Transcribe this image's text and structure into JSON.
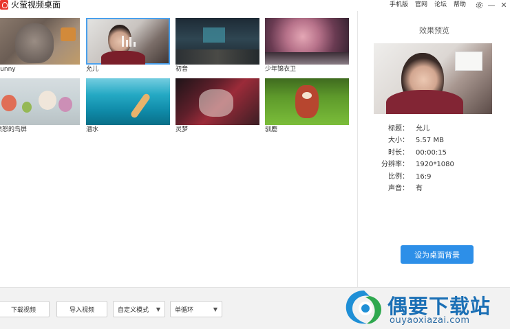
{
  "app": {
    "title": "火萤视频桌面"
  },
  "top_links": [
    "手机版",
    "官网",
    "论坛",
    "帮助"
  ],
  "window_controls": {
    "settings_icon": "gear-icon",
    "minimize": "—",
    "close": "✕"
  },
  "wallpapers": [
    {
      "label": "Bunny",
      "thumb": "bunny",
      "selected": false
    },
    {
      "label": "允儿",
      "thumb": "yun",
      "selected": true
    },
    {
      "label": "初音",
      "thumb": "miku",
      "selected": false
    },
    {
      "label": "少年锦衣卫",
      "thumb": "sakura",
      "selected": false
    },
    {
      "label": "愤怒的鸟屏",
      "thumb": "birds",
      "selected": false
    },
    {
      "label": "潜水",
      "thumb": "dive",
      "selected": false
    },
    {
      "label": "灵梦",
      "thumb": "lingmeng",
      "selected": false
    },
    {
      "label": "驯鹿",
      "thumb": "deer",
      "selected": false
    }
  ],
  "preview": {
    "title": "效果预览",
    "info": [
      {
        "key": "标题：",
        "value": "允儿"
      },
      {
        "key": "大小：",
        "value": "5.57 MB"
      },
      {
        "key": "时长：",
        "value": "00:00:15"
      },
      {
        "key": "分辨率：",
        "value": "1920*1080"
      },
      {
        "key": "比例：",
        "value": "16:9"
      },
      {
        "key": "声音：",
        "value": "有"
      }
    ],
    "set_button": "设为桌面背景"
  },
  "bottom": {
    "download_button": "下载视频",
    "import_button": "导入视频",
    "mode_select": "自定义模式",
    "loop_select": "单循环"
  },
  "watermark": {
    "name": "偶要下载站",
    "url": "ouyaoxiazai.com"
  },
  "colors": {
    "accent": "#2d8fe8",
    "selected_border": "#4aa0ec",
    "brand_red": "#e8382f",
    "watermark_blue": "#1a6fb5"
  }
}
